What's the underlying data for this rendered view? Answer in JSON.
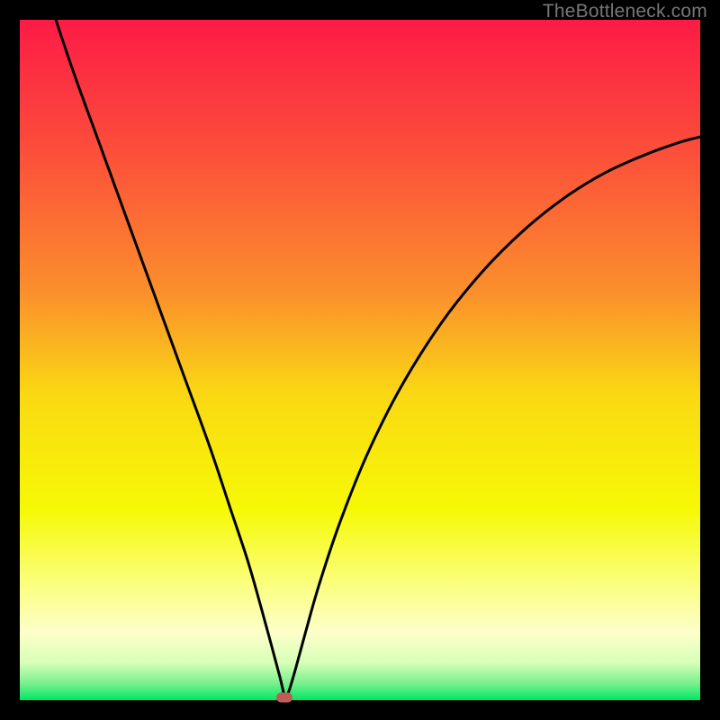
{
  "watermark": {
    "text": "TheBottleneck.com"
  },
  "chart_data": {
    "type": "line",
    "title": "",
    "xlabel": "",
    "ylabel": "",
    "xlim": [
      0,
      100
    ],
    "ylim": [
      0,
      100
    ],
    "gradient_stops": [
      {
        "offset": 0,
        "color": "#fd1b46"
      },
      {
        "offset": 0.2,
        "color": "#fc503a"
      },
      {
        "offset": 0.4,
        "color": "#fb8f2c"
      },
      {
        "offset": 0.55,
        "color": "#fad813"
      },
      {
        "offset": 0.72,
        "color": "#f6f905"
      },
      {
        "offset": 0.84,
        "color": "#fbff8a"
      },
      {
        "offset": 0.9,
        "color": "#fdffc9"
      },
      {
        "offset": 0.945,
        "color": "#d7ffb7"
      },
      {
        "offset": 0.975,
        "color": "#7af08e"
      },
      {
        "offset": 1.0,
        "color": "#00e763"
      }
    ],
    "series": [
      {
        "name": "bottleneck-curve",
        "x": [
          5.3,
          8,
          12,
          16,
          20,
          24,
          28,
          31,
          33.5,
          35.5,
          37,
          38.2,
          38.8,
          39.0,
          39.5,
          40.5,
          42,
          44,
          47,
          51,
          56,
          62,
          68,
          74,
          80,
          86,
          92,
          97,
          100
        ],
        "y": [
          100,
          92,
          81,
          70,
          59,
          48,
          37,
          28,
          20.5,
          13.5,
          8,
          3.5,
          1.0,
          0.4,
          1.2,
          4.5,
          10,
          17,
          26,
          36,
          46,
          55.5,
          63,
          69,
          73.8,
          77.5,
          80.2,
          82,
          82.8
        ]
      }
    ],
    "marker": {
      "x": 38.9,
      "y": 0.4,
      "color": "#c25a57"
    }
  }
}
